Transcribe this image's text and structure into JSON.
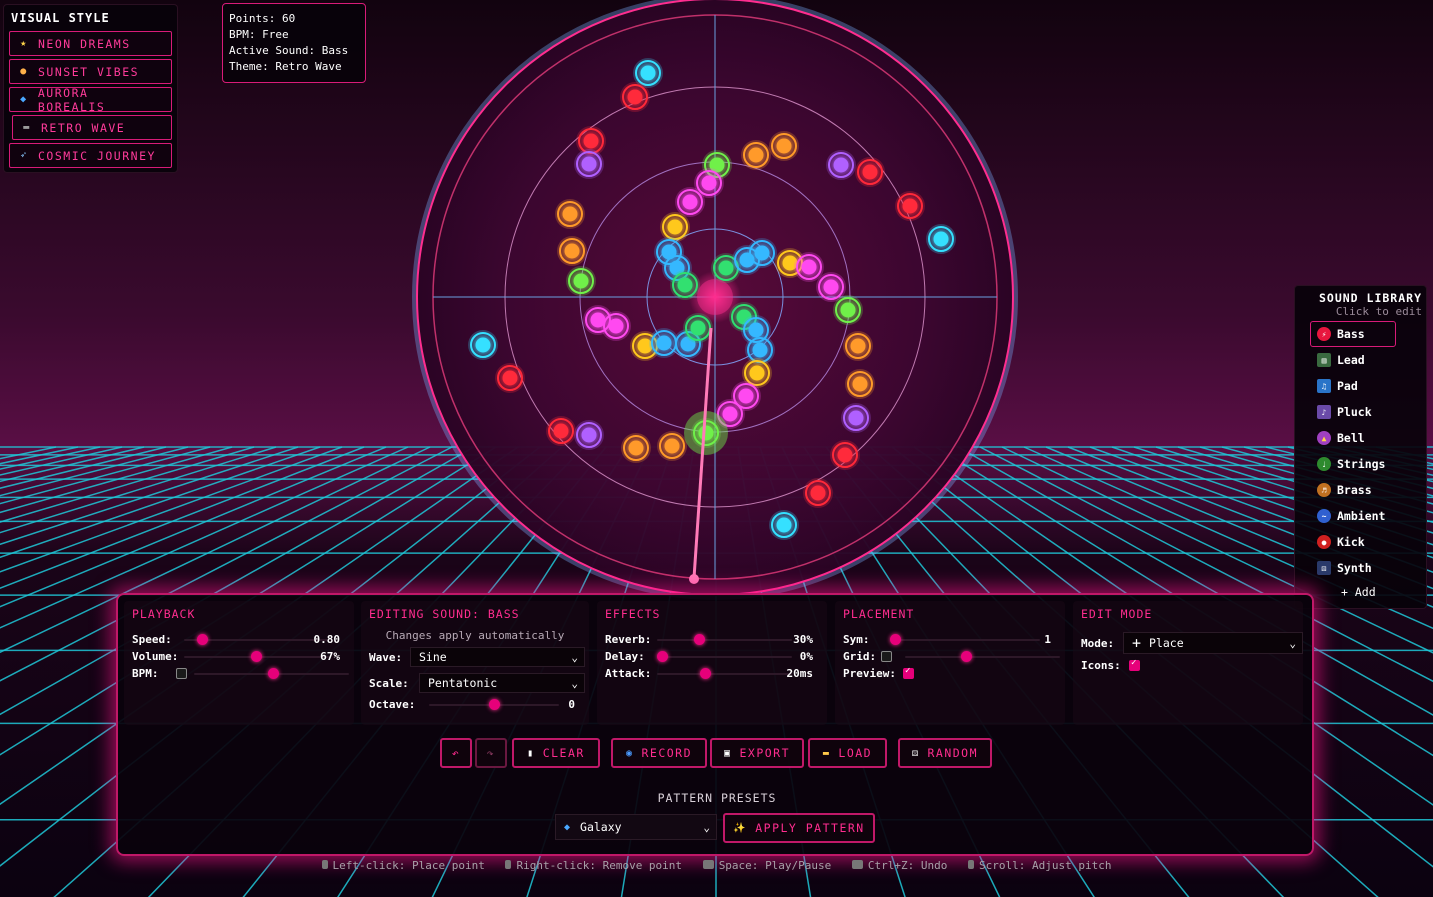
{
  "visual_style": {
    "title": "VISUAL STYLE",
    "items": [
      {
        "label": "NEON DREAMS",
        "icon": "star-icon"
      },
      {
        "label": "SUNSET VIBES",
        "icon": "sunset-icon"
      },
      {
        "label": "AURORA BOREALIS",
        "icon": "aurora-icon"
      },
      {
        "label": "RETRO WAVE",
        "icon": "gamepad-icon"
      },
      {
        "label": "COSMIC JOURNEY",
        "icon": "rocket-icon"
      }
    ]
  },
  "info": {
    "points": "Points: 60",
    "bpm": "BPM: Free",
    "active_sound": "Active Sound: Bass",
    "theme": "Theme: Retro Wave"
  },
  "sound_library": {
    "title": "SOUND LIBRARY",
    "subtitle": "Click to edit",
    "items": [
      {
        "label": "Bass",
        "color": "#e8163e"
      },
      {
        "label": "Lead",
        "color": "#3a6a40"
      },
      {
        "label": "Pad",
        "color": "#2a74c8"
      },
      {
        "label": "Pluck",
        "color": "#6a4aa8"
      },
      {
        "label": "Bell",
        "color": "#a040c0"
      },
      {
        "label": "Strings",
        "color": "#2e8a2e"
      },
      {
        "label": "Brass",
        "color": "#c07020"
      },
      {
        "label": "Ambient",
        "color": "#3060d0"
      },
      {
        "label": "Kick",
        "color": "#d02020"
      },
      {
        "label": "Synth",
        "color": "#2a3a6a"
      }
    ],
    "add_label": "+ Add"
  },
  "playback": {
    "title": "PLAYBACK",
    "speed_label": "Speed:",
    "speed_value": "0.80",
    "speed_fraction": 0.1,
    "volume_label": "Volume:",
    "volume_value": "67%",
    "volume_fraction": 0.5,
    "bpm_label": "BPM:",
    "bpm_enabled": false
  },
  "editing": {
    "title": "EDITING SOUND: BASS",
    "note": "Changes apply automatically",
    "wave_label": "Wave:",
    "wave_value": "Sine",
    "scale_label": "Scale:",
    "scale_value": "Pentatonic",
    "octave_label": "Octave:",
    "octave_value": "0",
    "octave_fraction": 0.5
  },
  "effects": {
    "title": "EFFECTS",
    "reverb_label": "Reverb:",
    "reverb_value": "30%",
    "reverb_fraction": 0.3,
    "delay_label": "Delay:",
    "delay_value": "0%",
    "delay_fraction": 0.0,
    "attack_label": "Attack:",
    "attack_value": "20ms",
    "attack_fraction": 0.35
  },
  "placement": {
    "title": "PLACEMENT",
    "sym_label": "Sym:",
    "sym_value": "1",
    "sym_fraction": 0.0,
    "grid_label": "Grid:",
    "grid_enabled": false,
    "preview_label": "Preview:",
    "preview_enabled": true
  },
  "edit_mode": {
    "title": "EDIT MODE",
    "mode_label": "Mode:",
    "mode_value": "Place",
    "icons_label": "Icons:",
    "icons_enabled": true
  },
  "actions": {
    "undo_icon": "undo-icon",
    "redo_icon": "redo-icon",
    "clear_label": "CLEAR",
    "record_label": "RECORD",
    "export_label": "EXPORT",
    "load_label": "LOAD",
    "random_label": "RANDOM"
  },
  "presets": {
    "title": "PATTERN PRESETS",
    "selected": "Galaxy",
    "apply_label": "APPLY PATTERN"
  },
  "shortcuts": [
    {
      "key": "Left-click:",
      "action": "Place point"
    },
    {
      "key": "Right-click:",
      "action": "Remove point"
    },
    {
      "key": "Space:",
      "action": "Play/Pause"
    },
    {
      "key": "Ctrl+Z:",
      "action": "Undo"
    },
    {
      "key": "Scroll:",
      "action": "Adjust pitch"
    }
  ],
  "colors": {
    "accent": "#ff2d8f",
    "grid": "#1fc8d8",
    "background": "#3a0a2e"
  }
}
